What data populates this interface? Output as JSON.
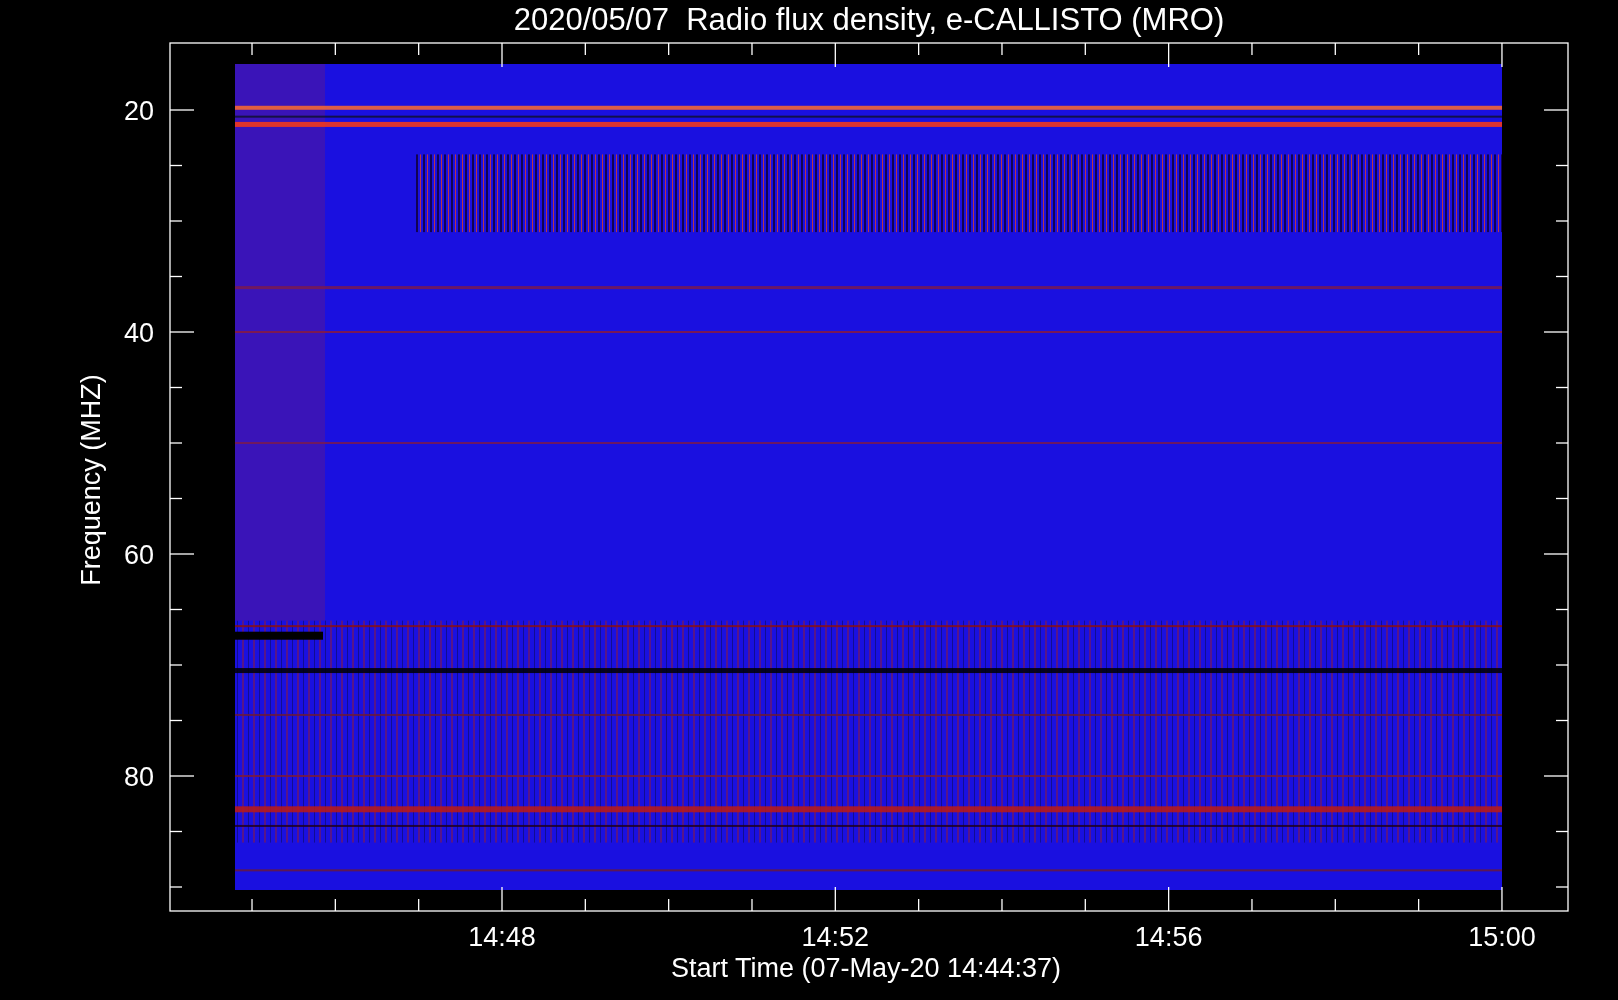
{
  "plot": {
    "title": "2020/05/07  Radio flux density, e-CALLISTO (MRO)",
    "ylabel": "Frequency (MHZ)",
    "xlabel": "Start Time (07-May-20 14:44:37)",
    "y_ticks": [
      "20",
      "40",
      "60",
      "80"
    ],
    "x_ticks": [
      "14:48",
      "14:52",
      "14:56",
      "15:00"
    ]
  }
}
